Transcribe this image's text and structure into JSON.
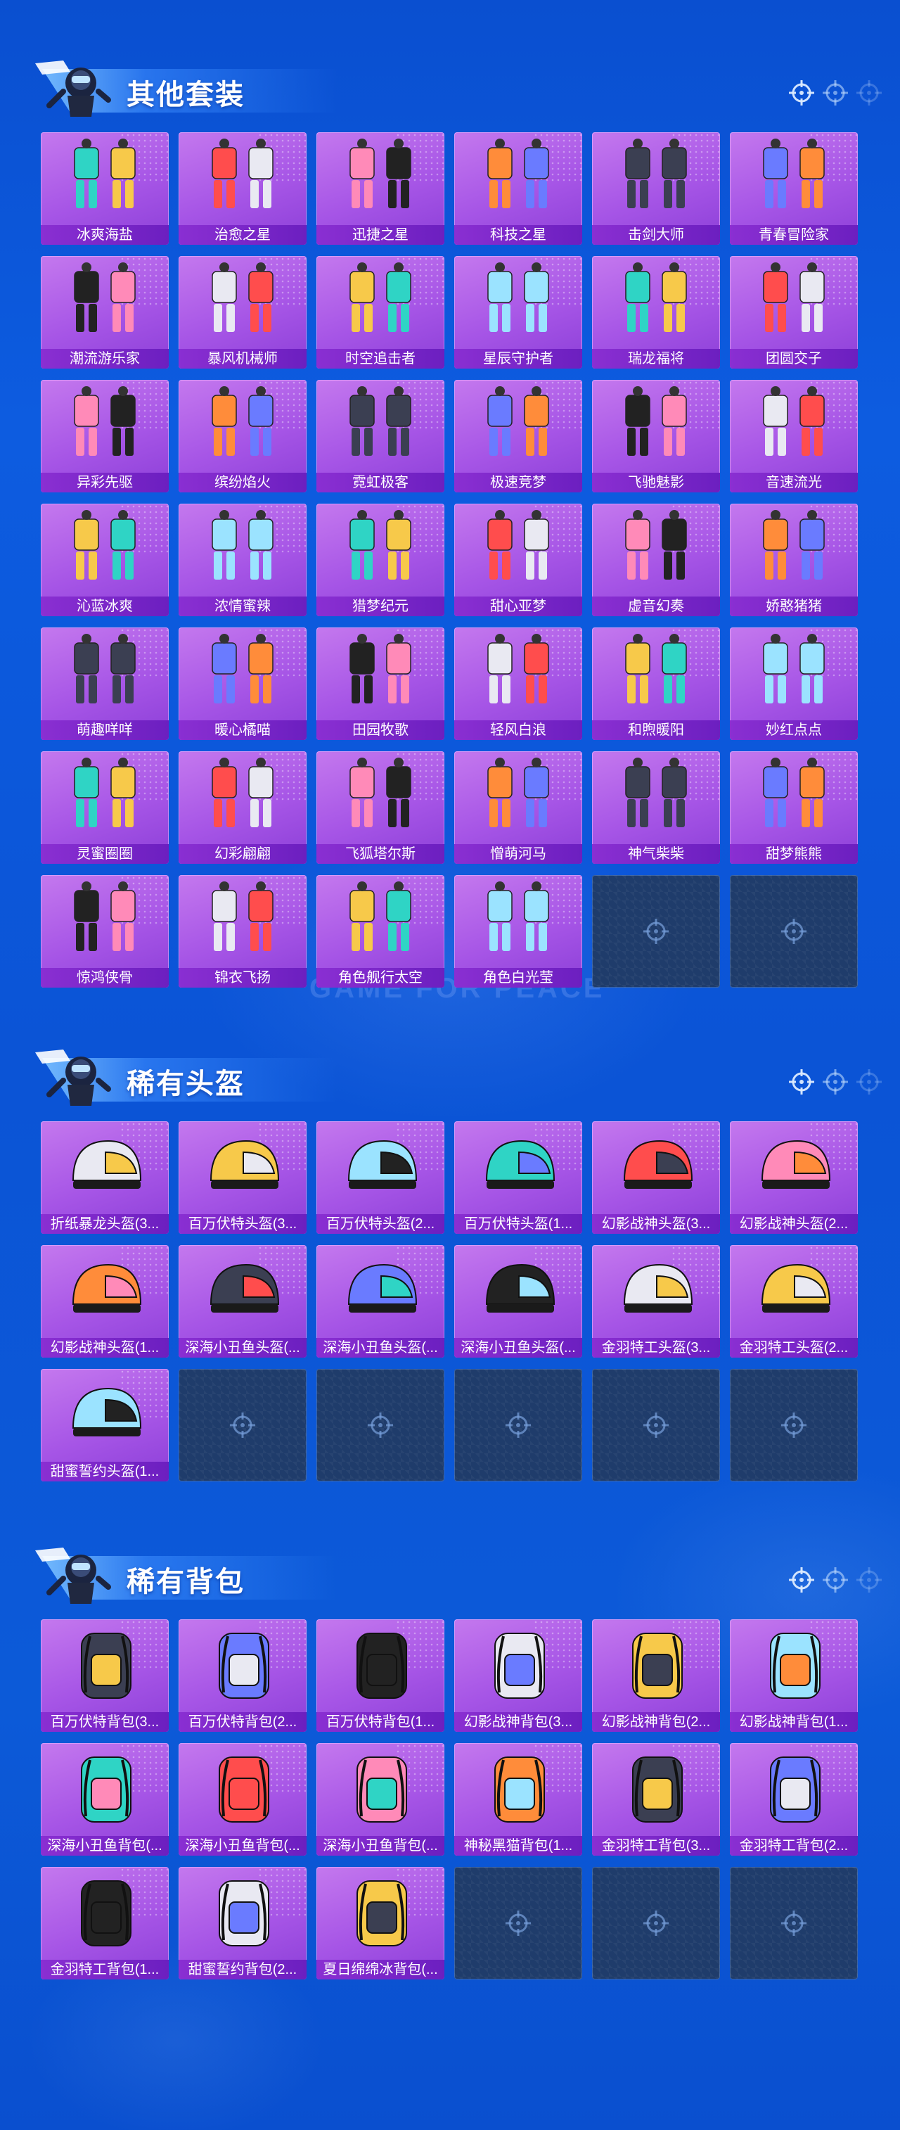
{
  "sections": [
    {
      "title": "其他套装",
      "items": [
        "冰爽海盐",
        "治愈之星",
        "迅捷之星",
        "科技之星",
        "击剑大师",
        "青春冒险家",
        "潮流游乐家",
        "暴风机械师",
        "时空追击者",
        "星辰守护者",
        "瑞龙福将",
        "团圆交子",
        "异彩先驱",
        "缤纷焰火",
        "霓虹极客",
        "极速竞梦",
        "飞驰魅影",
        "音速流光",
        "沁蓝冰爽",
        "浓情蜜辣",
        "猎梦纪元",
        "甜心亚梦",
        "虚音幻奏",
        "娇憨猪猪",
        "萌趣咩咩",
        "暖心橘喵",
        "田园牧歌",
        "轻风白浪",
        "和煦暖阳",
        "妙红点点",
        "灵蜜圈圈",
        "幻彩翩翩",
        "飞狐塔尔斯",
        "憎萌河马",
        "神气柴柴",
        "甜梦熊熊",
        "惊鸿侠骨",
        "锦衣飞扬",
        "角色舰行太空",
        "角色白光莹"
      ],
      "empty_slots": 2
    },
    {
      "title": "稀有头盔",
      "items": [
        "折纸暴龙头盔(3...",
        "百万伏特头盔(3...",
        "百万伏特头盔(2...",
        "百万伏特头盔(1...",
        "幻影战神头盔(3...",
        "幻影战神头盔(2...",
        "幻影战神头盔(1...",
        "深海小丑鱼头盔(...",
        "深海小丑鱼头盔(...",
        "深海小丑鱼头盔(...",
        "金羽特工头盔(3...",
        "金羽特工头盔(2...",
        "甜蜜誓约头盔(1..."
      ],
      "empty_slots": 5
    },
    {
      "title": "稀有背包",
      "items": [
        "百万伏特背包(3...",
        "百万伏特背包(2...",
        "百万伏特背包(1...",
        "幻影战神背包(3...",
        "幻影战神背包(2...",
        "幻影战神背包(1...",
        "深海小丑鱼背包(...",
        "深海小丑鱼背包(...",
        "深海小丑鱼背包(...",
        "神秘黑猫背包(1...",
        "金羽特工背包(3...",
        "金羽特工背包(2...",
        "金羽特工背包(1...",
        "甜蜜誓约背包(2...",
        "夏日绵绵冰背包(..."
      ],
      "empty_slots": 3
    }
  ],
  "watermark": "GAME FOR PEACE",
  "colors": {
    "background": "#0b55d8",
    "card": "#a655e6",
    "label_bar": "#7a25c8",
    "empty_slot": "#1f3c6b"
  },
  "icons": {
    "header_mascot": "parachute-character-icon",
    "header_deco": "crosshair-icon",
    "empty_slot": "crosshair-icon"
  }
}
